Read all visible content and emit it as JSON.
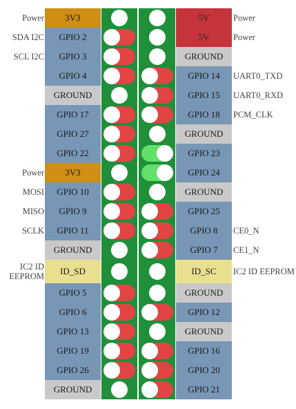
{
  "header": {
    "left_title": "",
    "right_title": ""
  },
  "rows": [
    {
      "ll": "Power",
      "lp": "3V3",
      "lt": "pwr3",
      "ls": "plain",
      "rs": "plain",
      "rp": "5V",
      "rt": "pwr5",
      "rl": "Power"
    },
    {
      "ll": "SDA I2C",
      "lp": "GPIO 2",
      "lt": "gpio",
      "ls": "red",
      "rs": "plain",
      "rp": "5V",
      "rt": "pwr5",
      "rl": "Power"
    },
    {
      "ll": "SCL I2C",
      "lp": "GPIO 3",
      "lt": "gpio",
      "ls": "red",
      "rs": "plain",
      "rp": "GROUND",
      "rt": "gnd",
      "rl": ""
    },
    {
      "ll": "",
      "lp": "GPIO 4",
      "lt": "gpio",
      "ls": "red",
      "rs": "red",
      "rp": "GPIO 14",
      "rt": "gpio",
      "rl": "UART0_TXD"
    },
    {
      "ll": "",
      "lp": "GROUND",
      "lt": "gnd",
      "ls": "plain",
      "rs": "red",
      "rp": "GPIO 15",
      "rt": "gpio",
      "rl": "UART0_RXD"
    },
    {
      "ll": "",
      "lp": "GPIO 17",
      "lt": "gpio",
      "ls": "red",
      "rs": "red",
      "rp": "GPIO 18",
      "rt": "gpio",
      "rl": "PCM_CLK"
    },
    {
      "ll": "",
      "lp": "GPIO 27",
      "lt": "gpio",
      "ls": "red",
      "rs": "plain",
      "rp": "GROUND",
      "rt": "gnd",
      "rl": ""
    },
    {
      "ll": "",
      "lp": "GPIO 22",
      "lt": "gpio",
      "ls": "red",
      "rs": "lime",
      "rp": "GPIO 23",
      "rt": "gpio",
      "rl": ""
    },
    {
      "ll": "Power",
      "lp": "3V3",
      "lt": "pwr3",
      "ls": "plain",
      "rs": "lime",
      "rp": "GPIO 24",
      "rt": "gpio",
      "rl": ""
    },
    {
      "ll": "MOSI",
      "lp": "GPIO 10",
      "lt": "gpio",
      "ls": "red",
      "rs": "plain",
      "rp": "GROUND",
      "rt": "gnd",
      "rl": ""
    },
    {
      "ll": "MISO",
      "lp": "GPIO 9",
      "lt": "gpio",
      "ls": "red",
      "rs": "red",
      "rp": "GPIO 25",
      "rt": "gpio",
      "rl": ""
    },
    {
      "ll": "SCLK",
      "lp": "GPIO 11",
      "lt": "gpio",
      "ls": "red",
      "rs": "red",
      "rp": "GPIO 8",
      "rt": "gpio",
      "rl": "CE0_N"
    },
    {
      "ll": "",
      "lp": "GROUND",
      "lt": "gnd",
      "ls": "plain",
      "rs": "red",
      "rp": "GPIO 7",
      "rt": "gpio",
      "rl": "CE1_N"
    },
    {
      "ll": "IC2 ID EEPROM",
      "lp": "ID_SD",
      "lt": "id",
      "ls": "plain",
      "rs": "plain",
      "rp": "ID_SC",
      "rt": "id",
      "rl": "IC2 ID EEPROM"
    },
    {
      "ll": "",
      "lp": "GPIO 5",
      "lt": "gpio",
      "ls": "red",
      "rs": "plain",
      "rp": "GROUND",
      "rt": "gnd",
      "rl": ""
    },
    {
      "ll": "",
      "lp": "GPIO 6",
      "lt": "gpio",
      "ls": "red",
      "rs": "red",
      "rp": "GPIO 12",
      "rt": "gpio",
      "rl": ""
    },
    {
      "ll": "",
      "lp": "GPIO 13",
      "lt": "gpio",
      "ls": "red",
      "rs": "plain",
      "rp": "GROUND",
      "rt": "gnd",
      "rl": ""
    },
    {
      "ll": "",
      "lp": "GPIO 19",
      "lt": "gpio",
      "ls": "red",
      "rs": "red",
      "rp": "GPIO 16",
      "rt": "gpio",
      "rl": ""
    },
    {
      "ll": "",
      "lp": "GPIO 26",
      "lt": "gpio",
      "ls": "red",
      "rs": "red",
      "rp": "GPIO 20",
      "rt": "gpio",
      "rl": ""
    },
    {
      "ll": "",
      "lp": "GROUND",
      "lt": "gnd",
      "ls": "plain",
      "rs": "red",
      "rp": "GPIO 21",
      "rt": "gpio",
      "rl": ""
    }
  ],
  "colors": {
    "power_3v3": "#cf8e14",
    "power_5v": "#c4343a",
    "gpio": "#7896b5",
    "ground": "#c9c9c9",
    "id": "#e8e08f",
    "switch_bg": "#1f8f3a",
    "switch_red": "#e24444",
    "switch_on": "#62e06a"
  }
}
